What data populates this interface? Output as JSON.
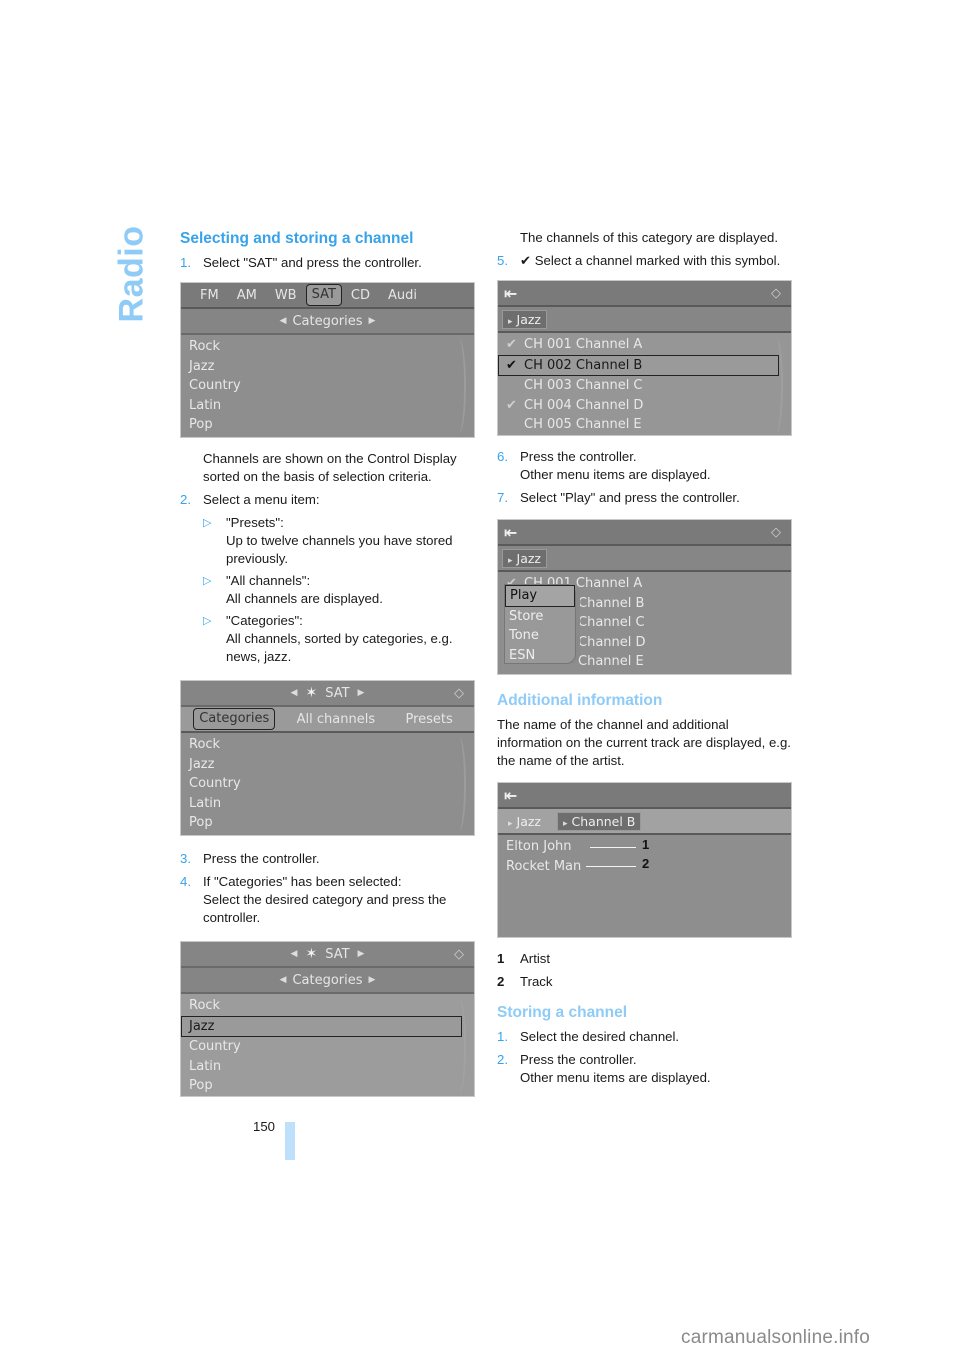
{
  "side_label": "Radio",
  "page_number": "150",
  "footer_site": "carmanualsonline.info",
  "colors": {
    "accent": "#36a3ea",
    "accent_light": "#8ecbf6",
    "screen_bg": "#8e8e8e",
    "page_bar": "#bfe0fb"
  },
  "section1": {
    "title": "Selecting and storing a channel",
    "step1": {
      "num": "1.",
      "text": "Select \"SAT\" and press the controller."
    },
    "screen1": {
      "tabs": [
        "FM",
        "AM",
        "WB",
        "SAT",
        "CD",
        "Audi"
      ],
      "active_tab": "SAT",
      "subtitle": "Categories",
      "items": [
        "Rock",
        "Jazz",
        "Country",
        "Latin",
        "Pop"
      ]
    },
    "after_screen1": "Channels are shown on the Control Display sorted on the basis of selection criteria.",
    "step2": {
      "num": "2.",
      "text": "Select a menu item:"
    },
    "bullets": [
      {
        "label": "\"Presets\":",
        "text": "Up to twelve channels you have stored previously."
      },
      {
        "label": "\"All channels\":",
        "text": "All channels are displayed."
      },
      {
        "label": "\"Categories\":",
        "text": "All channels, sorted by categories, e.g. news, jazz."
      }
    ],
    "screen2": {
      "title": "SAT",
      "tabs": [
        "Categories",
        "All channels",
        "Presets"
      ],
      "active_tab": "Categories",
      "items": [
        "Rock",
        "Jazz",
        "Country",
        "Latin",
        "Pop"
      ]
    },
    "step3": {
      "num": "3.",
      "text": "Press the controller."
    },
    "step4": {
      "num": "4.",
      "text": "If \"Categories\" has been selected:",
      "text2": "Select the desired category and press the controller."
    },
    "screen3": {
      "title": "SAT",
      "subtitle": "Categories",
      "items": [
        "Rock",
        "Jazz",
        "Country",
        "Latin",
        "Pop"
      ],
      "selected": "Jazz"
    },
    "after_screen3": "The channels of this category are displayed.",
    "step5": {
      "num": "5.",
      "text": "Select a channel marked with this symbol."
    },
    "screen4": {
      "crumb": "Jazz",
      "channels": [
        {
          "label": "CH 001 Channel A",
          "checked": true,
          "selected": false
        },
        {
          "label": "CH 002 Channel B",
          "checked": true,
          "selected": true
        },
        {
          "label": "CH 003 Channel C",
          "checked": false,
          "selected": false
        },
        {
          "label": "CH 004 Channel D",
          "checked": true,
          "selected": false
        },
        {
          "label": "CH 005 Channel E",
          "checked": false,
          "selected": false
        }
      ]
    },
    "step6": {
      "num": "6.",
      "text": "Press the controller.",
      "text2": "Other menu items are displayed."
    },
    "step7": {
      "num": "7.",
      "text": "Select \"Play\" and press the controller."
    },
    "screen5": {
      "crumb": "Jazz",
      "channels": [
        "CH 001 Channel A",
        "Channel B",
        "Channel C",
        "Channel D",
        "Channel E"
      ],
      "popup": [
        "Play",
        "Store",
        "Tone",
        "ESN"
      ],
      "popup_selected": "Play"
    }
  },
  "section2": {
    "title": "Additional information",
    "text": "The name of the channel and additional information on the current track are displayed, e.g. the name of the artist.",
    "screen6": {
      "crumb1": "Jazz",
      "crumb2": "Channel B",
      "line1": "Elton John",
      "line2": "Rocket Man",
      "callout1": "1",
      "callout2": "2"
    },
    "legend": [
      {
        "num": "1",
        "text": "Artist"
      },
      {
        "num": "2",
        "text": "Track"
      }
    ]
  },
  "section3": {
    "title": "Storing a channel",
    "step1": {
      "num": "1.",
      "text": "Select the desired channel."
    },
    "step2": {
      "num": "2.",
      "text": "Press the controller.",
      "text2": "Other menu items are displayed."
    }
  }
}
